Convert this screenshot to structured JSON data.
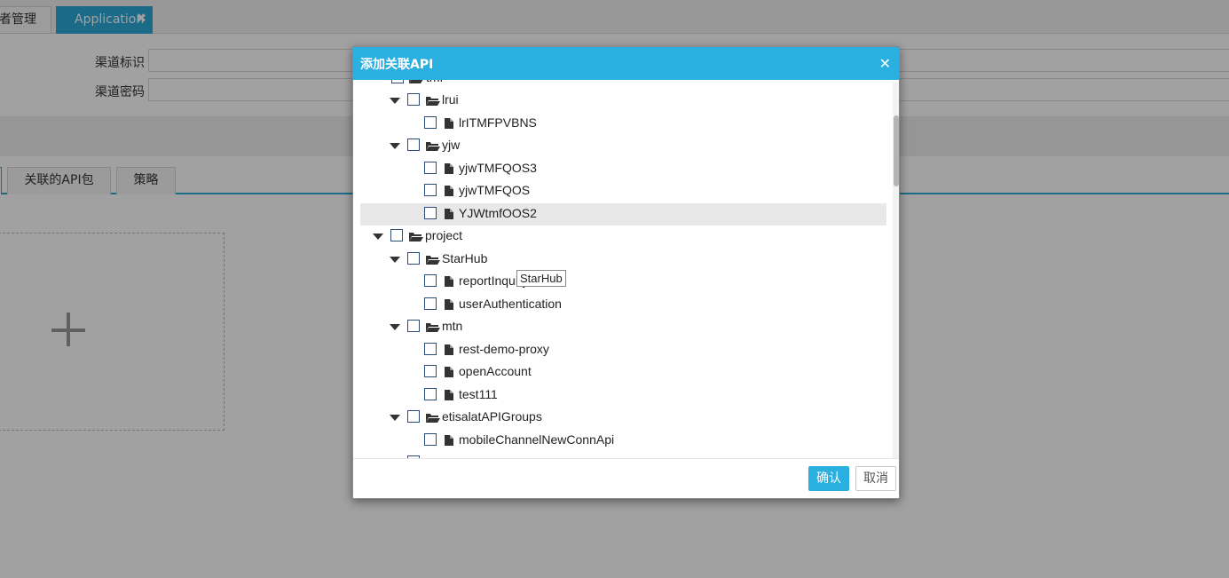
{
  "page_tabs": [
    {
      "label": "者管理"
    },
    {
      "label": "Application",
      "close": "✖"
    }
  ],
  "form": {
    "channel_id_label": "渠道标识",
    "channel_pwd_label": "渠道密码"
  },
  "sub_tabs": [
    {
      "label": "关联的API包"
    },
    {
      "label": "策略"
    }
  ],
  "modal": {
    "title": "添加关联API",
    "close": "✕",
    "tooltip": "StarHub",
    "tree": [
      {
        "label": "tmf",
        "type": "folder",
        "level": 2
      },
      {
        "label": "lrui",
        "type": "folder",
        "level": 2
      },
      {
        "label": "lrITMFPVBNS",
        "type": "file",
        "level": 3
      },
      {
        "label": "yjw",
        "type": "folder",
        "level": 2
      },
      {
        "label": "yjwTMFQOS3",
        "type": "file",
        "level": 3
      },
      {
        "label": "yjwTMFQOS",
        "type": "file",
        "level": 3
      },
      {
        "label": "YJWtmfOOS2",
        "type": "file",
        "level": 3,
        "highlighted": true
      },
      {
        "label": "project",
        "type": "folder",
        "level": 1
      },
      {
        "label": "StarHub",
        "type": "folder",
        "level": 2
      },
      {
        "label": "reportInquiry",
        "type": "file",
        "level": 3
      },
      {
        "label": "userAuthentication",
        "type": "file",
        "level": 3
      },
      {
        "label": "mtn",
        "type": "folder",
        "level": 2
      },
      {
        "label": "rest-demo-proxy",
        "type": "file",
        "level": 3
      },
      {
        "label": "openAccount",
        "type": "file",
        "level": 3
      },
      {
        "label": "test111",
        "type": "file",
        "level": 3
      },
      {
        "label": "etisalatAPIGroups",
        "type": "folder",
        "level": 2
      },
      {
        "label": "mobileChannelNewConnApi",
        "type": "file",
        "level": 3
      },
      {
        "label": "",
        "type": "folder",
        "level": 2
      }
    ],
    "ok_label": "确认",
    "cancel_label": "取消"
  },
  "colors": {
    "accent": "#2ab0e0",
    "overlay": "rgba(0,0,0,0.37)",
    "checkbox_border": "#2a4d7a"
  }
}
